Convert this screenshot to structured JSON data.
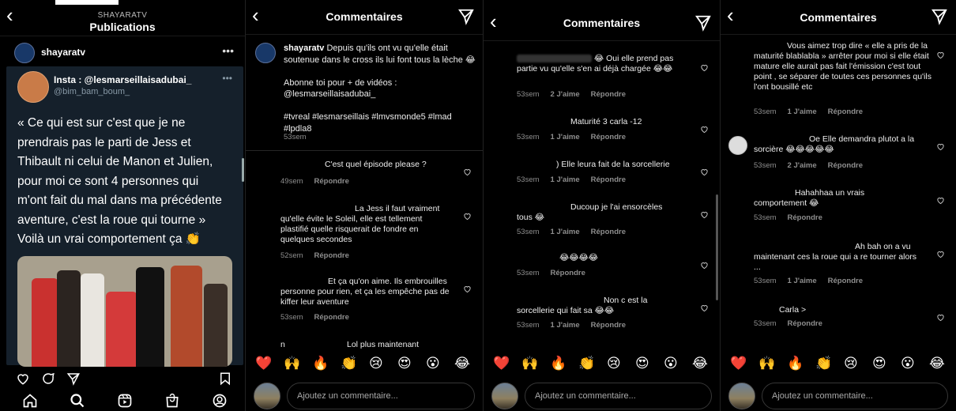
{
  "p1": {
    "brand": "SHAYARATV",
    "title": "Publications",
    "post_author": "shayaratv",
    "more": "•••",
    "tweet": {
      "name": "Insta : @lesmarseillaisadubai_",
      "handle": "@bim_bam_boum_",
      "more": "•••",
      "text": "« Ce qui est sur c'est que je ne prendrais pas le parti de Jess et Thibault ni celui de Manon et Julien, pour moi ce sont 4 personnes qui m'ont fait du mal dans ma précédente aventure, c'est la roue qui tourne » Voilà un vrai comportement ça 👏"
    },
    "actions": [
      "heart-icon",
      "comment-icon",
      "share-icon",
      "bookmark-icon"
    ],
    "nav": [
      "home-icon",
      "search-icon",
      "reels-icon",
      "shop-icon",
      "profile-icon"
    ]
  },
  "p2": {
    "title": "Commentaires",
    "caption": {
      "author": "shayaratv",
      "text": "Depuis qu'ils ont vu qu'elle était soutenue dans le cross ils lui font tous la lèche 😂",
      "line2": "Abonne toi pour + de vidéos : @lesmarseillaisadubai_",
      "line3": "#tvreal #lesmarseillais #lmvsmonde5 #lmad #lpdla8",
      "time": "53sem"
    },
    "comments": [
      {
        "text": "C'est quel épisode please ?",
        "time": "49sem",
        "likes": "",
        "reply": "Répondre"
      },
      {
        "text": "La Jess il faut vraiment qu'elle évite le Soleil, elle est tellement plastifié quelle risquerait de fondre en quelques secondes",
        "time": "52sem",
        "likes": "",
        "reply": "Répondre"
      },
      {
        "text": "Et ça qu'on aime. Ils embrouilles personne pour rien, et ça les empêche pas de kiffer leur aventure",
        "time": "53sem",
        "likes": "",
        "reply": "Répondre"
      },
      {
        "text": "Lol plus maintenant",
        "time": "",
        "likes": "",
        "reply": ""
      }
    ]
  },
  "p3": {
    "title": "Commentaires",
    "comments": [
      {
        "text": "😂 Oui elle prend pas partie vu qu'elle s'en ai déjà chargée 😂😂",
        "time": "53sem",
        "likes": "2 J'aime",
        "reply": "Répondre"
      },
      {
        "text": "Maturité 3 carla -12",
        "time": "53sem",
        "likes": "1 J'aime",
        "reply": "Répondre"
      },
      {
        "text": ") Elle leura fait de la sorcellerie",
        "time": "53sem",
        "likes": "1 J'aime",
        "reply": "Répondre"
      },
      {
        "text": "Ducoup je l'ai ensorcèles tous 😂",
        "time": "53sem",
        "likes": "1 J'aime",
        "reply": "Répondre"
      },
      {
        "text": "😂😂😂😂",
        "time": "53sem",
        "likes": "",
        "reply": "Répondre"
      },
      {
        "text": "Non c est la sorcellerie qui fait sa 😂😂",
        "time": "53sem",
        "likes": "1 J'aime",
        "reply": "Répondre"
      }
    ]
  },
  "p4": {
    "title": "Commentaires",
    "comments": [
      {
        "text": "Vous aimez trop dire « elle a pris de la maturité blablabla » arrêter pour moi si elle était mature elle aurait pas fait l'émission c'est tout point , se séparer de toutes ces personnes qu'ils l'ont bousillé etc",
        "time": "53sem",
        "likes": "1 J'aime",
        "reply": "Répondre"
      },
      {
        "text": "Oe Elle demandra plutot a la sorcière 😂😂😂😂😂",
        "time": "53sem",
        "likes": "2 J'aime",
        "reply": "Répondre"
      },
      {
        "text": "Hahahhaa un vrais comportement 😂",
        "time": "53sem",
        "likes": "",
        "reply": "Répondre"
      },
      {
        "text": "Ah bah on a vu maintenant ces la roue qui a re tourner alors ...",
        "time": "53sem",
        "likes": "1 J'aime",
        "reply": "Répondre"
      },
      {
        "text": "Carla >",
        "time": "53sem",
        "likes": "",
        "reply": "Répondre"
      }
    ]
  },
  "emojis": [
    "❤️",
    "🙌",
    "🔥",
    "👏",
    "😢",
    "😍",
    "😮",
    "😂"
  ],
  "composer_placeholder": "Ajoutez un commentaire..."
}
